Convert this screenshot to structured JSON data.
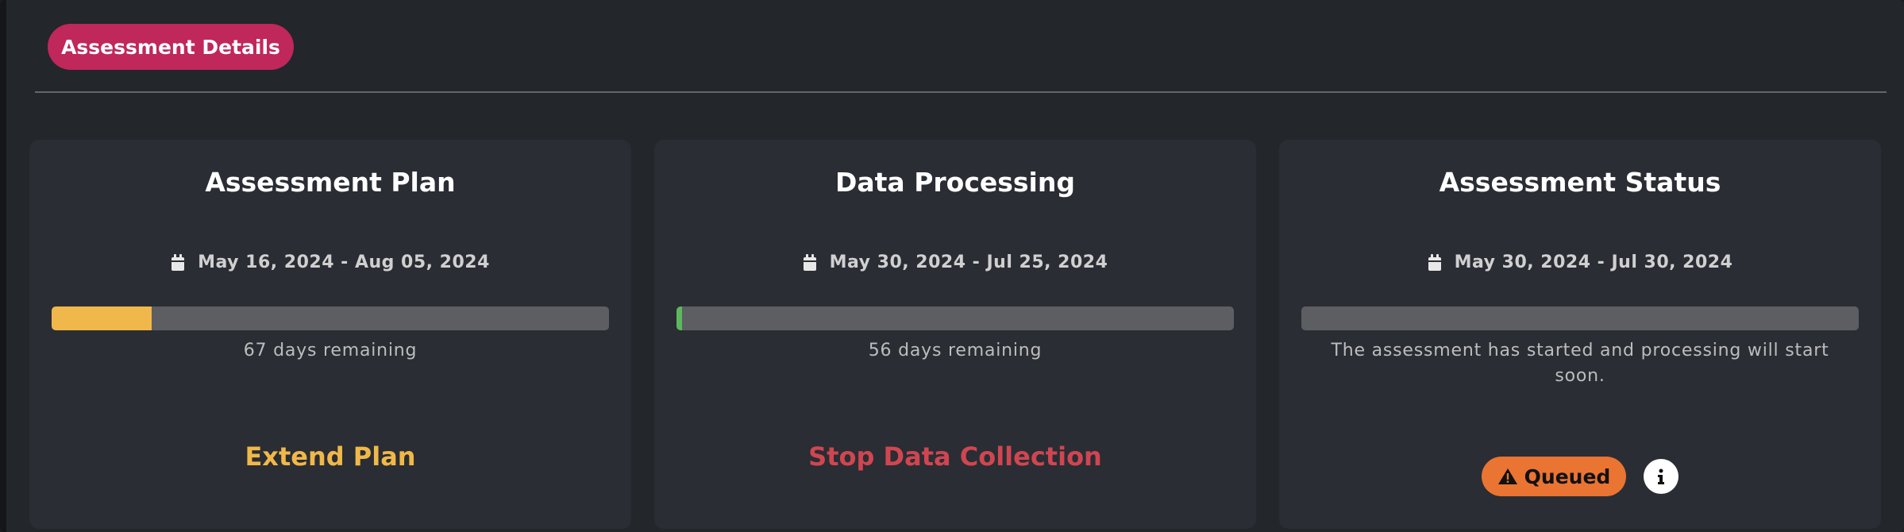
{
  "header": {
    "pill_label": "Assessment Details"
  },
  "cards": [
    {
      "title": "Assessment Plan",
      "date_range": "May 16, 2024 - Aug 05, 2024",
      "progress_fraction": 0.18,
      "progress_color": "#f0b84a",
      "remaining": "67 days remaining",
      "action_label": "Extend Plan",
      "action_color": "#f0b84a"
    },
    {
      "title": "Data Processing",
      "date_range": "May 30, 2024 - Jul 25, 2024",
      "progress_fraction": 0.01,
      "progress_color": "#5cb85c",
      "remaining": "56 days remaining",
      "action_label": "Stop Data Collection",
      "action_color": "#cf4651"
    },
    {
      "title": "Assessment Status",
      "date_range": "May 30, 2024 - Jul 30, 2024",
      "progress_fraction": 0,
      "progress_color": "#5c5e62",
      "message": "The assessment has started and processing will start soon.",
      "status_badge": "Queued",
      "status_color": "#ea7432",
      "status_icon": "warning-icon",
      "info_icon": "info-icon"
    }
  ],
  "colors": {
    "accent": "#c0275a",
    "background": "#23262b",
    "card": "#2a2d33"
  }
}
